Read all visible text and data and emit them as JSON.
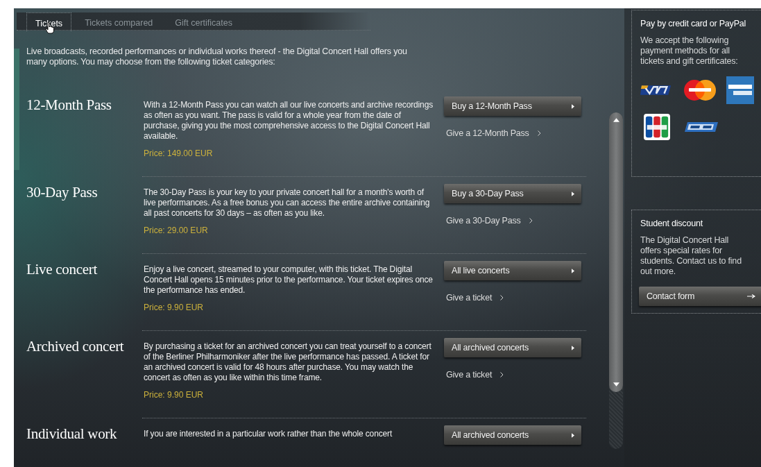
{
  "tabs": [
    {
      "label": "Tickets",
      "selected": true
    },
    {
      "label": "Tickets compared",
      "selected": false
    },
    {
      "label": "Gift certificates",
      "selected": false
    }
  ],
  "intro": "Live broadcasts, recorded performances or individual works thereof - the Digital Concert Hall offers you many options. You may choose from the following ticket categories:",
  "categories": [
    {
      "title": "12-Month Pass",
      "description": "With a 12-Month Pass you can watch all our live concerts and archive recordings as often as you want. The pass is valid for a whole year from the date of purchase, giving you the most comprehensive access to the Digital Concert Hall available.",
      "price": "Price: 149.00 EUR",
      "button": "Buy a 12-Month Pass",
      "gift_link": "Give a 12-Month Pass"
    },
    {
      "title": "30-Day Pass",
      "description": "The 30-Day Pass is your key to your private concert hall for a month's worth of live performances. As a free bonus you can access the entire archive containing all past concerts for 30 days – as often as you like.",
      "price": "Price: 29.00 EUR",
      "button": "Buy a 30-Day Pass",
      "gift_link": "Give a 30-Day Pass"
    },
    {
      "title": "Live concert",
      "description": "Enjoy a live concert, streamed to your computer, with this ticket. The Digital Concert Hall opens 15 minutes prior to the performance. Your ticket expires once the performance has ended.",
      "price": "Price: 9.90 EUR",
      "button": "All live concerts",
      "gift_link": "Give a ticket"
    },
    {
      "title": "Archived concert",
      "description": "By purchasing a ticket for an archived concert you can treat yourself to a concert of the Berliner Philharmoniker after the live performance has passed. A ticket for an archived concert is valid for 48 hours after purchase. You may watch the concert as often as you like within this time frame.",
      "price": "Price: 9.90 EUR",
      "button": "All archived concerts",
      "gift_link": "Give a ticket"
    },
    {
      "title": "Individual work",
      "description": "If you are interested in a particular work rather than the whole concert",
      "button": "All archived concerts"
    }
  ],
  "sidebar": {
    "payment": {
      "title": "Pay by credit card or PayPal",
      "text": "We accept the following payment methods for all tickets and gift certificates:",
      "methods": [
        {
          "kind": "visa"
        },
        {
          "kind": "mastercard"
        },
        {
          "kind": "amex"
        },
        {
          "kind": "jcb"
        },
        {
          "kind": "paypal"
        }
      ]
    },
    "student": {
      "title": "Student discount",
      "text": "The Digital Concert Hall offers special rates for students. Contact us to find out more.",
      "button": "Contact form"
    }
  }
}
